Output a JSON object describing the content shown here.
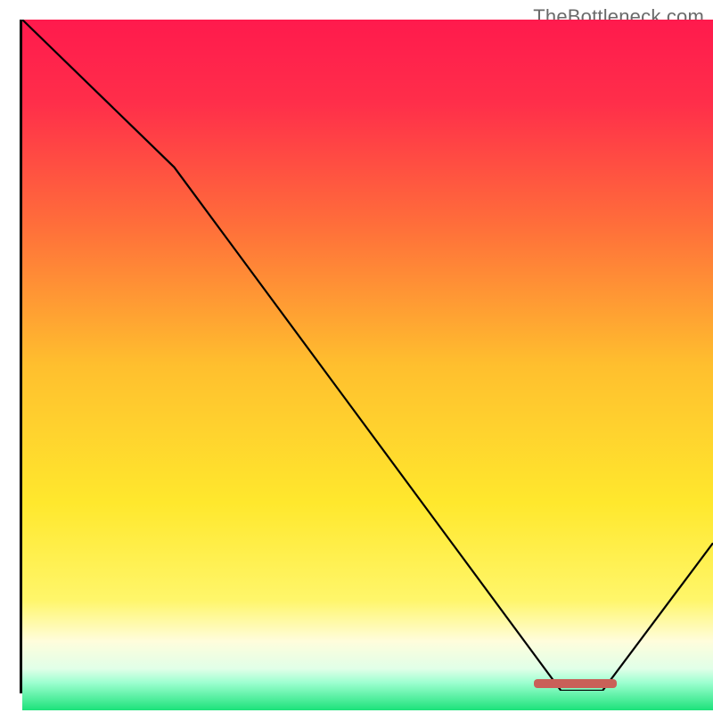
{
  "watermark": "TheBottleneck.com",
  "chart_data": {
    "type": "line",
    "title": "",
    "xlabel": "",
    "ylabel": "",
    "xlim": [
      0,
      100
    ],
    "ylim": [
      0,
      100
    ],
    "x": [
      0,
      10,
      22,
      78,
      84,
      100
    ],
    "values": [
      100,
      90,
      78,
      0,
      0,
      22
    ],
    "annotations": [
      {
        "type": "marker",
        "x_start": 74,
        "x_end": 86,
        "y": 1,
        "color": "#c96058"
      }
    ],
    "gradient": {
      "stops": [
        {
          "pos": 0.0,
          "color": "#ff1a4d"
        },
        {
          "pos": 0.12,
          "color": "#ff2e4a"
        },
        {
          "pos": 0.3,
          "color": "#ff6f3a"
        },
        {
          "pos": 0.5,
          "color": "#ffbf2e"
        },
        {
          "pos": 0.7,
          "color": "#ffe82d"
        },
        {
          "pos": 0.84,
          "color": "#fff66a"
        },
        {
          "pos": 0.9,
          "color": "#fffddc"
        },
        {
          "pos": 0.94,
          "color": "#e0ffe8"
        },
        {
          "pos": 0.96,
          "color": "#9dffd0"
        },
        {
          "pos": 1.0,
          "color": "#1ce27a"
        }
      ]
    }
  }
}
